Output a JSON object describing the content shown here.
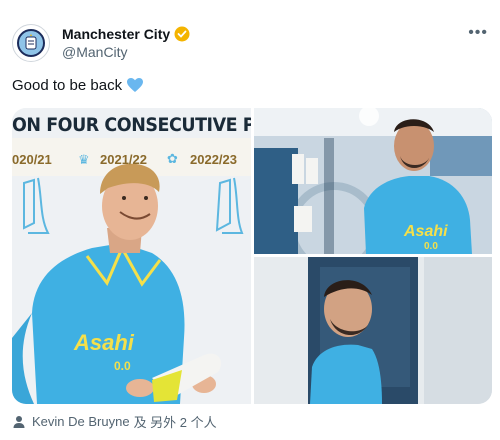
{
  "account": {
    "display_name": "Manchester City",
    "handle": "@ManCity"
  },
  "tweet": {
    "text": "Good to be back"
  },
  "media": {
    "left": {
      "banner": "ON FOUR CONSECUTIVE PI",
      "seasons": [
        "020/21",
        "2021/22",
        "2022/23"
      ],
      "sponsor": "Asahi 0.0"
    },
    "top_right": {
      "sponsor": "Asahi 0.0"
    }
  },
  "tags": {
    "person": "Kevin De Bruyne",
    "suffix": "及 另外 2 个人"
  },
  "colors": {
    "sky_blue": "#46b3e6",
    "verified": "#f4b400",
    "heart": "#6ab7ef"
  },
  "icons": [
    "avatar-crest",
    "verified-badge-icon",
    "more-icon",
    "heart-icon",
    "person-icon",
    "crown-icon"
  ]
}
